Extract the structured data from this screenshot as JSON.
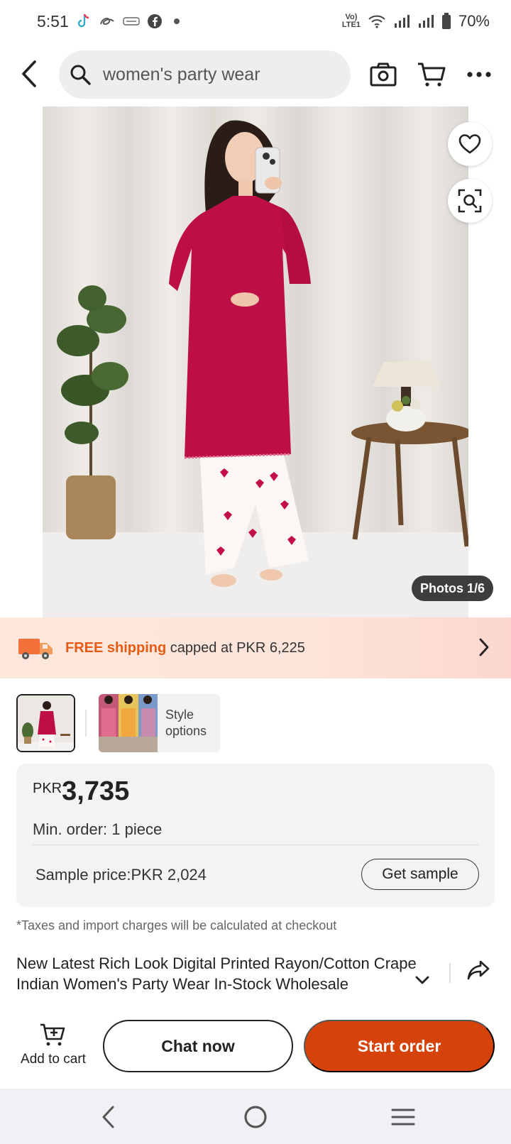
{
  "status_bar": {
    "time": "5:51",
    "battery": "70%",
    "notification_icons": [
      "tiktok-icon",
      "app-icon",
      "temu-icon",
      "facebook-icon",
      "dot-icon"
    ],
    "lte_label": "LTE1"
  },
  "top_nav": {
    "search_query": "women's party wear"
  },
  "gallery": {
    "photo_counter": "Photos 1/6"
  },
  "shipping_banner": {
    "highlight": "FREE shipping",
    "rest": " capped at PKR 6,225"
  },
  "variants": {
    "style_options_label": "Style options"
  },
  "price": {
    "currency": "PKR",
    "value": "3,735",
    "min_order": "Min. order: 1 piece",
    "sample_price": "Sample price:PKR 2,024",
    "get_sample_label": "Get sample"
  },
  "tax_note": "*Taxes and import charges will be calculated at checkout",
  "product": {
    "title": "New Latest Rich Look Digital Printed Rayon/Cotton Crape Indian Women's Party Wear In-Stock Wholesale"
  },
  "actions": {
    "add_to_cart_label": "Add to cart",
    "chat_now_label": "Chat now",
    "start_order_label": "Start order"
  },
  "colors": {
    "accent": "#d5430b",
    "shipping_highlight": "#e55b13",
    "banner_bg": "#fde7dc"
  }
}
